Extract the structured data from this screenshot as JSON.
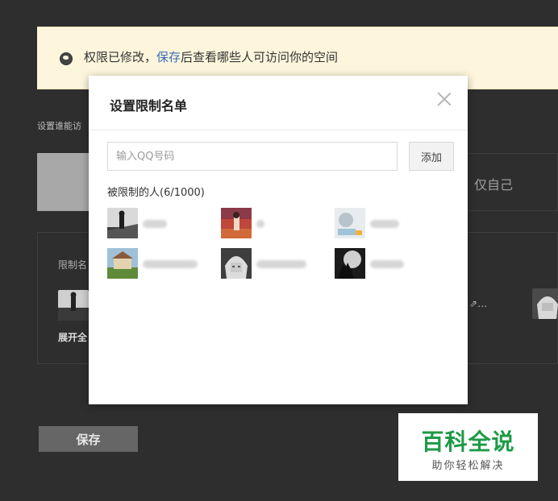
{
  "notice": {
    "prefix": "权限已修改，",
    "link": "保存",
    "suffix": "后查看哪些人可访问你的空间"
  },
  "settings": {
    "label": "设置谁能访",
    "scope_option_self": "仅自己",
    "restrict_label": "限制名",
    "expand_all": "展开全",
    "more": "…"
  },
  "save_button": "保存",
  "modal": {
    "title": "设置限制名单",
    "input_placeholder": "输入QQ号码",
    "add_button": "添加",
    "restricted_count": "被限制的人(6/1000)",
    "users": [
      {
        "name": "",
        "avatar": "man-on-rocks"
      },
      {
        "name": "",
        "avatar": "person-red-scene"
      },
      {
        "name": "",
        "avatar": "cartoon-girl-white"
      },
      {
        "name": "",
        "avatar": "house-on-hill"
      },
      {
        "name": "",
        "avatar": "anime-silver-hair"
      },
      {
        "name": "",
        "avatar": "wolf-howling-moon"
      }
    ]
  },
  "watermark": {
    "title": "百科全说",
    "subtitle": "助你轻松解决"
  }
}
